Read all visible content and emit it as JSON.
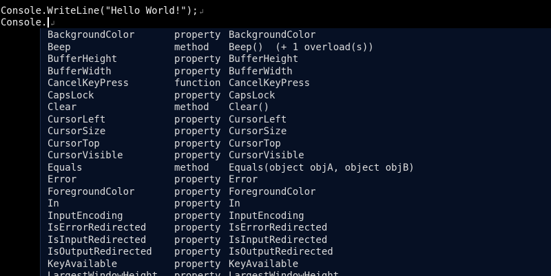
{
  "code": {
    "line1": {
      "prefix": "Console.WriteLine(",
      "string": "\"Hello World!\"",
      "suffix": ");",
      "return_mark": "↲"
    },
    "line2": {
      "text": "Console.",
      "return_mark": "↲"
    }
  },
  "completion": {
    "items": [
      {
        "name": "BackgroundColor",
        "kind": "property",
        "signature": "BackgroundColor"
      },
      {
        "name": "Beep",
        "kind": "method",
        "signature": "Beep()  (+ 1 overload(s))"
      },
      {
        "name": "BufferHeight",
        "kind": "property",
        "signature": "BufferHeight"
      },
      {
        "name": "BufferWidth",
        "kind": "property",
        "signature": "BufferWidth"
      },
      {
        "name": "CancelKeyPress",
        "kind": "function",
        "signature": "CancelKeyPress"
      },
      {
        "name": "CapsLock",
        "kind": "property",
        "signature": "CapsLock"
      },
      {
        "name": "Clear",
        "kind": "method",
        "signature": "Clear()"
      },
      {
        "name": "CursorLeft",
        "kind": "property",
        "signature": "CursorLeft"
      },
      {
        "name": "CursorSize",
        "kind": "property",
        "signature": "CursorSize"
      },
      {
        "name": "CursorTop",
        "kind": "property",
        "signature": "CursorTop"
      },
      {
        "name": "CursorVisible",
        "kind": "property",
        "signature": "CursorVisible"
      },
      {
        "name": "Equals",
        "kind": "method",
        "signature": "Equals(object objA, object objB)"
      },
      {
        "name": "Error",
        "kind": "property",
        "signature": "Error"
      },
      {
        "name": "ForegroundColor",
        "kind": "property",
        "signature": "ForegroundColor"
      },
      {
        "name": "In",
        "kind": "property",
        "signature": "In"
      },
      {
        "name": "InputEncoding",
        "kind": "property",
        "signature": "InputEncoding"
      },
      {
        "name": "IsErrorRedirected",
        "kind": "property",
        "signature": "IsErrorRedirected"
      },
      {
        "name": "IsInputRedirected",
        "kind": "property",
        "signature": "IsInputRedirected"
      },
      {
        "name": "IsOutputRedirected",
        "kind": "property",
        "signature": "IsOutputRedirected"
      },
      {
        "name": "KeyAvailable",
        "kind": "property",
        "signature": "KeyAvailable"
      },
      {
        "name": "LargestWindowHeight",
        "kind": "property",
        "signature": "LargestWindowHeight"
      }
    ]
  },
  "colors": {
    "background": "#000000",
    "popup_background": "#061024",
    "text": "#dcdcdc"
  }
}
